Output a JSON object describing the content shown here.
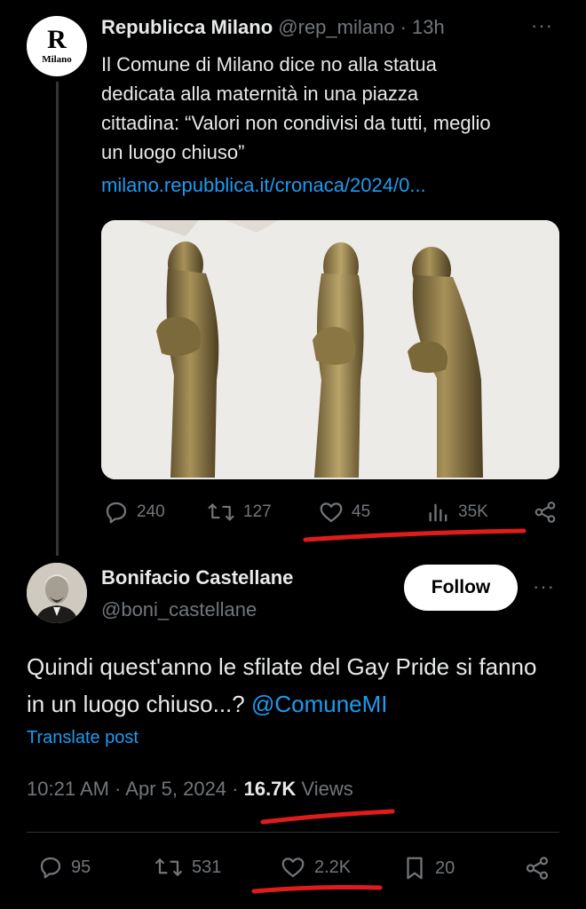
{
  "tweet1": {
    "avatar_letter": "R",
    "avatar_sub": "Milano",
    "name": "Republicca Milano",
    "handle": "@rep_milano",
    "separator": " · ",
    "time": "13h",
    "more": "···",
    "text": "Il Comune di Milano dice no alla statua dedicata alla maternità in una piazza cittadina: “Valori non condivisi da tutti, meglio un luogo chiuso”",
    "link": "milano.repubblica.it/cronaca/2024/0...",
    "stats": {
      "replies": "240",
      "reposts": "127",
      "likes": "45",
      "views": "35K"
    },
    "icons": [
      "reply-icon",
      "repost-icon",
      "like-icon",
      "views-icon",
      "share-icon"
    ]
  },
  "tweet2": {
    "name": "Bonifacio Castellane",
    "handle": "@boni_castellane",
    "follow_label": "Follow",
    "more": "···",
    "text_main": "Quindi quest'anno le sfilate del Gay Pride si fanno in un luogo chiuso...? ",
    "mention": "@ComuneMI",
    "translate": "Translate post",
    "timestamp": "10:21 AM · Apr 5, 2024 · ",
    "views_count": "16.7K",
    "views_label": " Views",
    "stats": {
      "replies": "95",
      "reposts": "531",
      "likes": "2.2K",
      "bookmarks": "20"
    },
    "icons": [
      "reply-icon",
      "repost-icon",
      "like-icon",
      "bookmark-icon",
      "share-icon"
    ]
  },
  "colors": {
    "background": "#000000",
    "text": "#e7e9ea",
    "muted": "#71767b",
    "link": "#1d9bf0",
    "annotation": "#e01b1b"
  }
}
